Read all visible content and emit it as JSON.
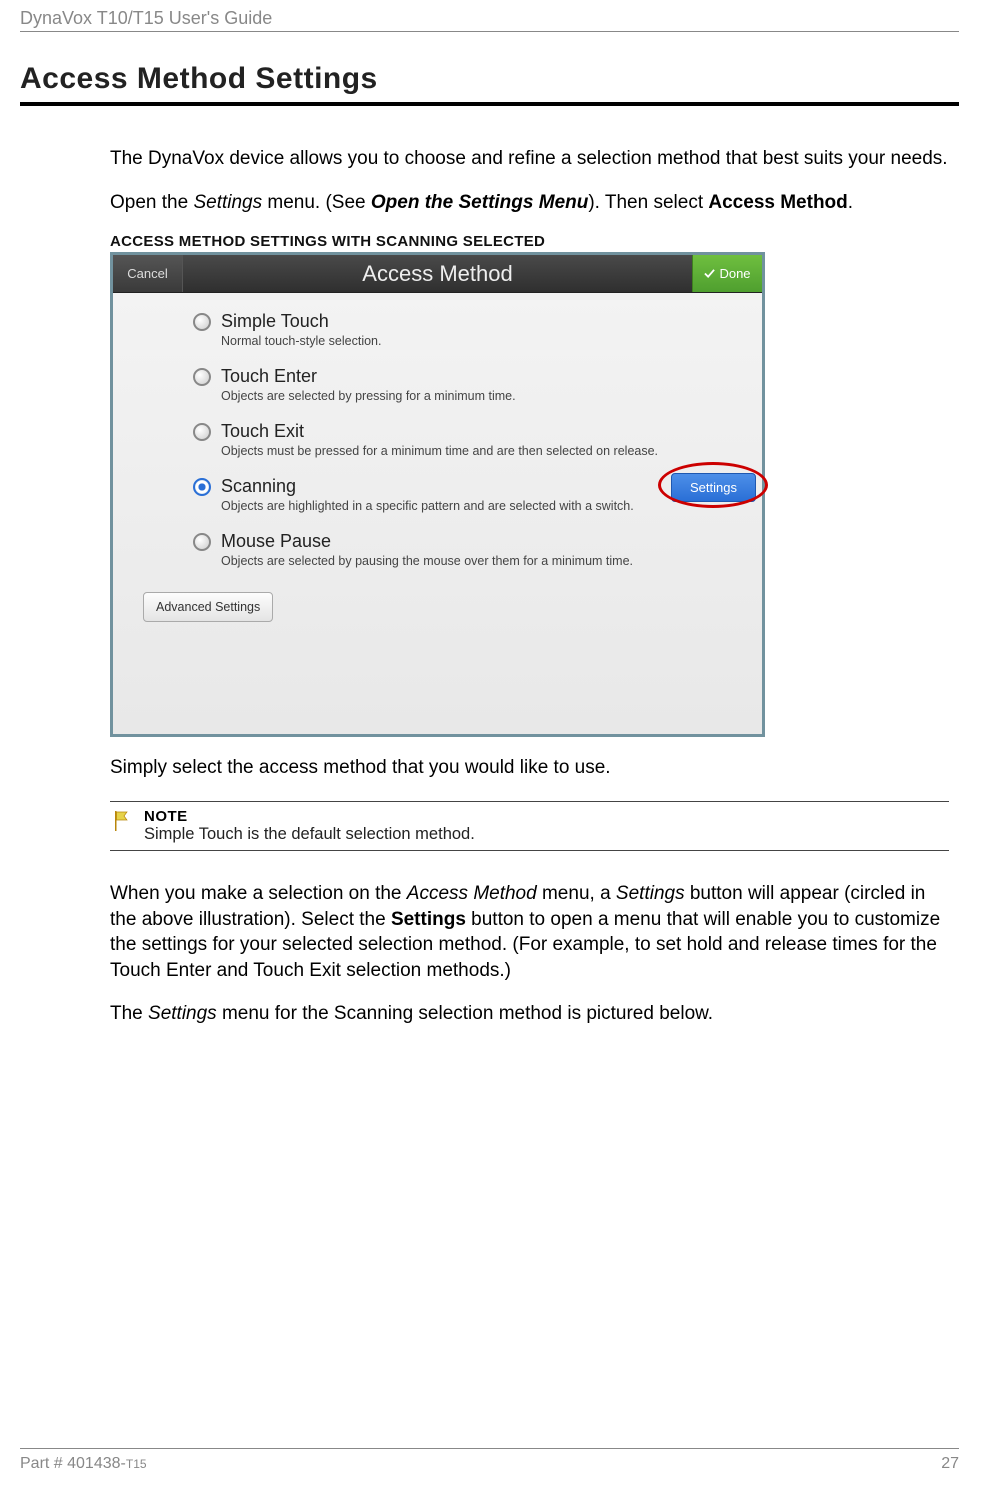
{
  "doc_header": "DynaVox T10/T15 User's Guide",
  "section_title": "Access Method Settings",
  "para1": "The DynaVox device allows you to choose and refine a selection method that best suits your needs.",
  "para2_pre": "Open the ",
  "para2_em1": "Settings",
  "para2_mid1": " menu. (See ",
  "para2_strongem": "Open the Settings Menu",
  "para2_mid2": "). Then select ",
  "para2_strong": "Access Method",
  "para2_end": ".",
  "caption": "ACCESS METHOD SETTINGS WITH SCANNING SELECTED",
  "screenshot": {
    "cancel": "Cancel",
    "title": "Access Method",
    "done": "Done",
    "options": [
      {
        "label": "Simple Touch",
        "desc": "Normal touch-style selection."
      },
      {
        "label": "Touch Enter",
        "desc": "Objects are selected by pressing for a minimum time."
      },
      {
        "label": "Touch Exit",
        "desc": "Objects must be pressed for a minimum time and are then selected on release."
      },
      {
        "label": "Scanning",
        "desc": "Objects are highlighted in a specific pattern and are selected with a switch."
      },
      {
        "label": "Mouse Pause",
        "desc": "Objects are selected by pausing the mouse over them for a minimum time."
      }
    ],
    "settings_btn": "Settings",
    "advanced": "Advanced Settings"
  },
  "para3": "Simply select the access method that you would like to use.",
  "note": {
    "title": "NOTE",
    "body": "Simple Touch is the default selection method."
  },
  "para4_pre": "When you make a selection on the ",
  "para4_em1": "Access Method",
  "para4_mid1": " menu, a ",
  "para4_em2": "Settings",
  "para4_mid2": " button will appear (circled in the above illustration). Select the ",
  "para4_strong": "Settings",
  "para4_end": " button to open a menu that will enable you to customize the settings for your selected selection method. (For example, to set hold and release times for the Touch Enter and Touch Exit selection methods.)",
  "para5_pre": "The ",
  "para5_em": "Settings",
  "para5_end": " menu for the Scanning selection method is pictured below.",
  "footer": {
    "part_prefix": "Part # 401438-",
    "part_suffix": "T15",
    "page": "27"
  }
}
